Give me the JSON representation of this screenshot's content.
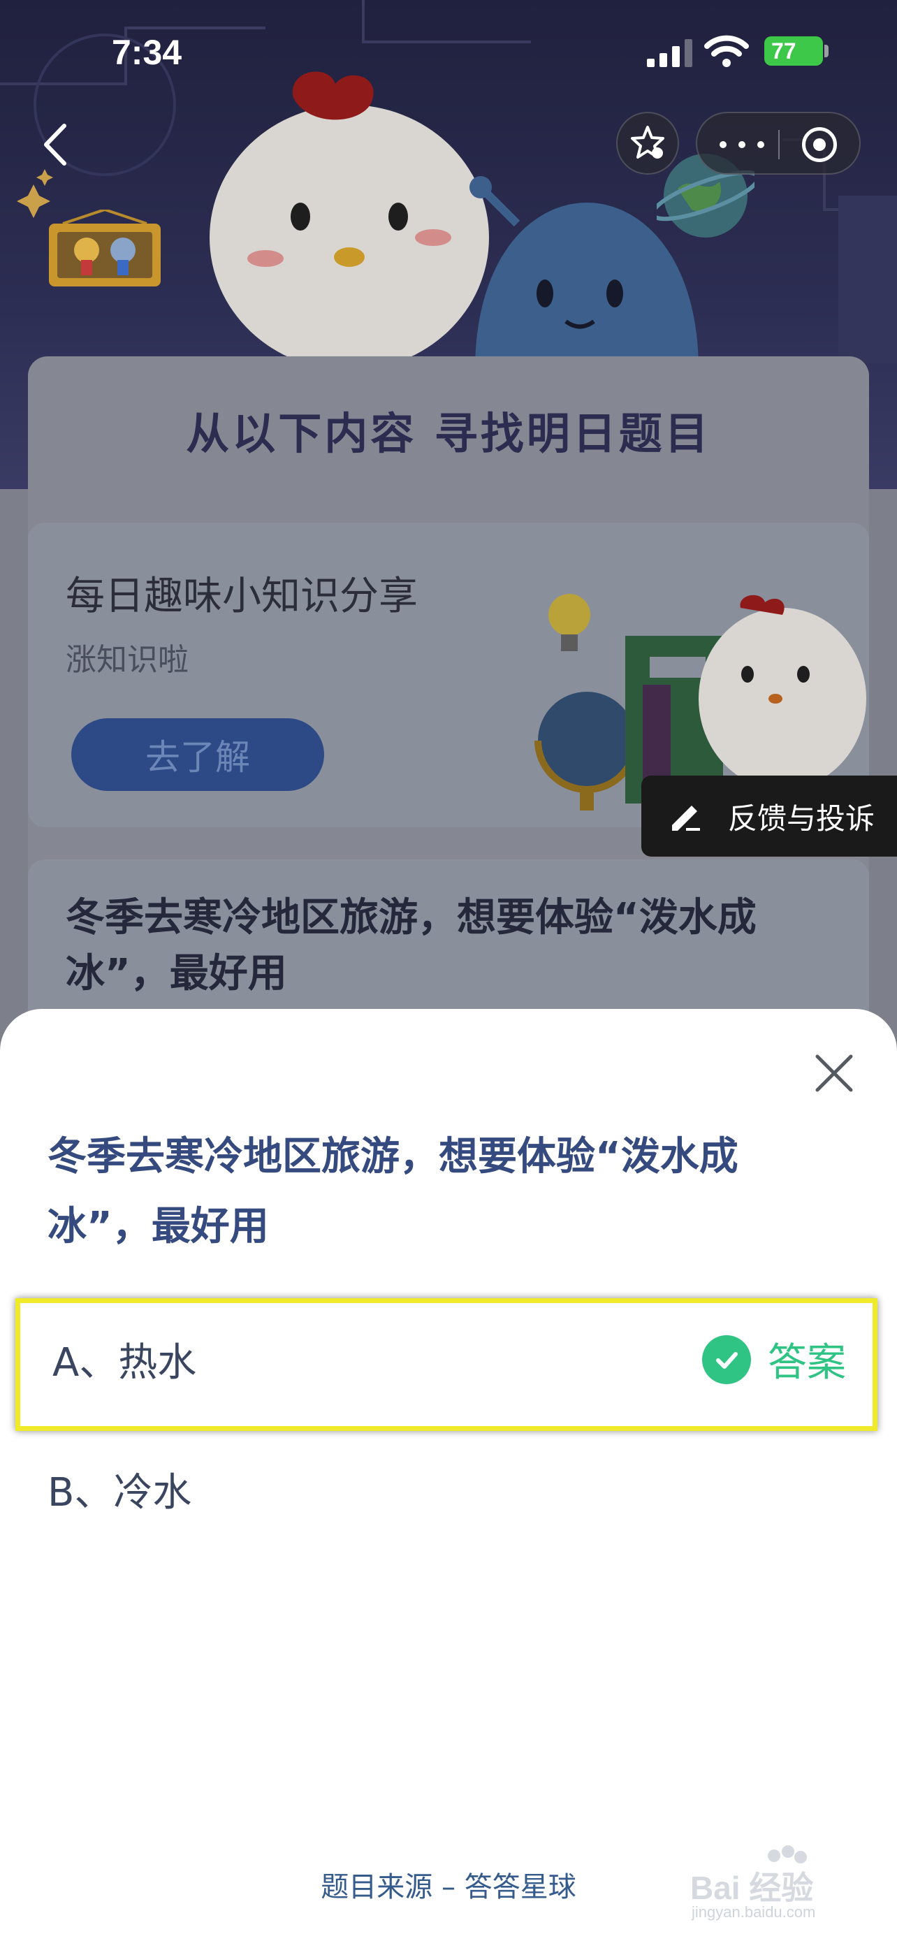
{
  "status_bar": {
    "time": "7:34",
    "battery": "77"
  },
  "hero": {
    "heading": "从以下内容 寻找明日题目"
  },
  "knowledge_card": {
    "title": "每日趣味小知识分享",
    "subtitle": "涨知识啦",
    "button_label": "去了解"
  },
  "feedback": {
    "label": "反馈与投诉"
  },
  "background_question": {
    "text": "冬季去寒冷地区旅游，想要体验“泼水成冰”，最好用"
  },
  "sheet": {
    "question": "冬季去寒冷地区旅游，想要体验“泼水成冰”，最好用",
    "options": [
      {
        "label": "A、热水",
        "is_answer": true
      },
      {
        "label": "B、冷水",
        "is_answer": false
      }
    ],
    "answer_label": "答案",
    "source": "题目来源 – 答答星球"
  },
  "watermark": {
    "brand": "Bai 经验",
    "url": "jingyan.baidu.com"
  },
  "colors": {
    "accent_green": "#2fc384",
    "question_blue": "#354a7e",
    "highlight_yellow": "#f0eb2a"
  },
  "icons": [
    "back-icon",
    "star-icon",
    "more-icon",
    "target-icon",
    "edit-icon",
    "close-icon",
    "check-icon"
  ]
}
